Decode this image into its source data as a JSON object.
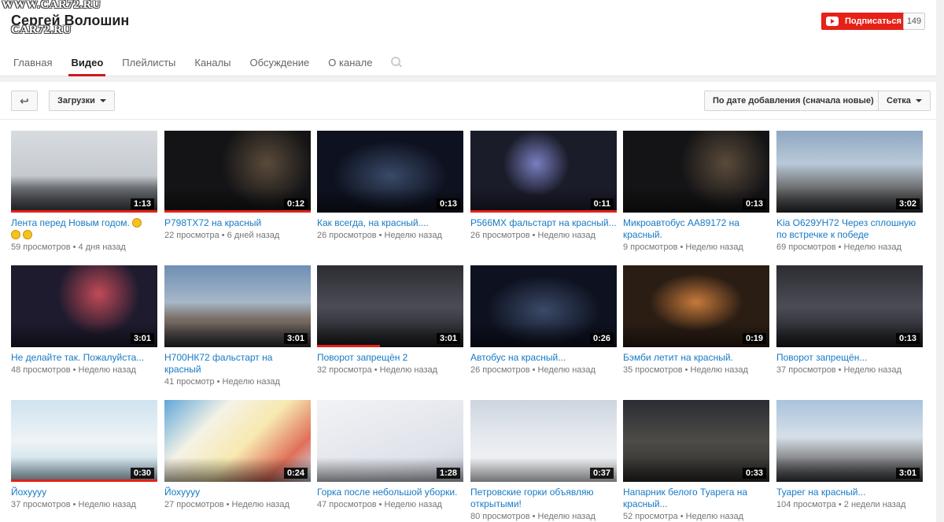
{
  "watermark": {
    "line1": "WWW.CAR72.RU",
    "line2": "CAR72.RU"
  },
  "channel": {
    "name": "Сергей Волошин",
    "subscribe_label": "Подписаться",
    "subscriber_count": "149",
    "accent": "#e62117"
  },
  "tabs": [
    {
      "label": "Главная"
    },
    {
      "label": "Видео"
    },
    {
      "label": "Плейлисты"
    },
    {
      "label": "Каналы"
    },
    {
      "label": "Обсуждение"
    },
    {
      "label": "О канале"
    }
  ],
  "toolbar": {
    "back_icon": "arrow-left-icon",
    "uploads_label": "Загрузки",
    "sort_label": "По дате добавления (сначала новые)",
    "view_label": "Сетка"
  },
  "videos": [
    {
      "title": "Лента перед Новым годом.",
      "views": "59 просмотров",
      "age": "4 дня назад",
      "duration": "1:13",
      "progress": 1.0
    },
    {
      "title": "Р798ТХ72 на красный",
      "views": "22 просмотра",
      "age": "6 дней назад",
      "duration": "0:12",
      "progress": 1.0
    },
    {
      "title": "Как всегда, на красный....",
      "views": "26 просмотров",
      "age": "Неделю назад",
      "duration": "0:13",
      "progress": 0
    },
    {
      "title": "Р566МХ фальстарт на красный...",
      "views": "26 просмотров",
      "age": "Неделю назад",
      "duration": "0:11",
      "progress": 1.0
    },
    {
      "title": "Микроавтобус АА89172 на красный.",
      "views": "9 просмотров",
      "age": "Неделю назад",
      "duration": "0:13",
      "progress": 0
    },
    {
      "title": "Kia O629УН72 Через сплошную по встречке к победе",
      "views": "69 просмотров",
      "age": "Неделю назад",
      "duration": "3:02",
      "progress": 0
    },
    {
      "title": "Не делайте так. Пожалуйста...",
      "views": "48 просмотров",
      "age": "Неделю назад",
      "duration": "3:01",
      "progress": 0
    },
    {
      "title": "Н700НК72 фальстарт на красный",
      "views": "41 просмотр",
      "age": "Неделю назад",
      "duration": "3:01",
      "progress": 0
    },
    {
      "title": "Поворот запрещён 2",
      "views": "32 просмотра",
      "age": "Неделю назад",
      "duration": "3:01",
      "progress": 0.43
    },
    {
      "title": "Автобус на красный...",
      "views": "26 просмотров",
      "age": "Неделю назад",
      "duration": "0:26",
      "progress": 0
    },
    {
      "title": "Бэмби летит на красный.",
      "views": "35 просмотров",
      "age": "Неделю назад",
      "duration": "0:19",
      "progress": 0
    },
    {
      "title": "Поворот запрещён...",
      "views": "37 просмотров",
      "age": "Неделю назад",
      "duration": "0:13",
      "progress": 0
    },
    {
      "title": "Йохуууу",
      "views": "37 просмотров",
      "age": "Неделю назад",
      "duration": "0:30",
      "progress": 1.0
    },
    {
      "title": "Йохуууу",
      "views": "27 просмотров",
      "age": "Неделю назад",
      "duration": "0:24",
      "progress": 0
    },
    {
      "title": "Горка после небольшой уборки.",
      "views": "47 просмотров",
      "age": "Неделю назад",
      "duration": "1:28",
      "progress": 0
    },
    {
      "title": "Петровские горки объявляю открытыми!",
      "views": "80 просмотров",
      "age": "Неделю назад",
      "duration": "0:37",
      "progress": 0
    },
    {
      "title": "Напарник белого Туарега на красный...",
      "views": "52 просмотра",
      "age": "Неделю назад",
      "duration": "0:33",
      "progress": 0
    },
    {
      "title": "Туарег на красный...",
      "views": "104 просмотра",
      "age": "2 недели назад",
      "duration": "3:01",
      "progress": 0
    }
  ]
}
